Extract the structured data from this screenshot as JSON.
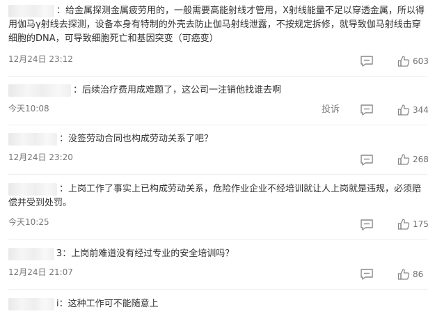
{
  "comments": [
    {
      "user_suffix": "：",
      "text": "给金属探测金属疲劳用的，一般需要高能射线才管用，X射线能量不足以穿透金属，所以得用伽马γ射线去探测，设备本身有特制的外壳去防止伽马射线泄露，不按规定拆修，就导致伽马射线击穿细胞的DNA，可导致细胞死亡和基因突变（可癌变）",
      "time": "12月24日 23:12",
      "likes": "603"
    },
    {
      "user_suffix": "：",
      "text": "后续治疗费用成难题了，这公司一注销他找谁去啊",
      "time": "今天10:08",
      "report_label": "投诉",
      "likes": "344"
    },
    {
      "user_suffix": "：",
      "text": "没签劳动合同也构成劳动关系了吧？",
      "time": "12月24日 23:20",
      "likes": "268"
    },
    {
      "user_suffix": "：",
      "text": "上岗工作了事实上已构成劳动关系，危险作业企业不经培训就让人上岗就是违规，必须赔偿并受到处罚。",
      "time": "今天10:25",
      "likes": "175"
    },
    {
      "user_suffix": "3：",
      "text": "上岗前难道没有经过专业的安全培训吗？",
      "time": "12月24日 21:07",
      "likes": "86"
    },
    {
      "user_suffix": "i：",
      "text": "这种工作可不能随意上"
    }
  ],
  "icons": {
    "reply": "comment-bubble-icon",
    "like": "thumbs-up-icon"
  },
  "colors": {
    "text": "#333333",
    "meta": "#777777",
    "icon": "#888888"
  }
}
